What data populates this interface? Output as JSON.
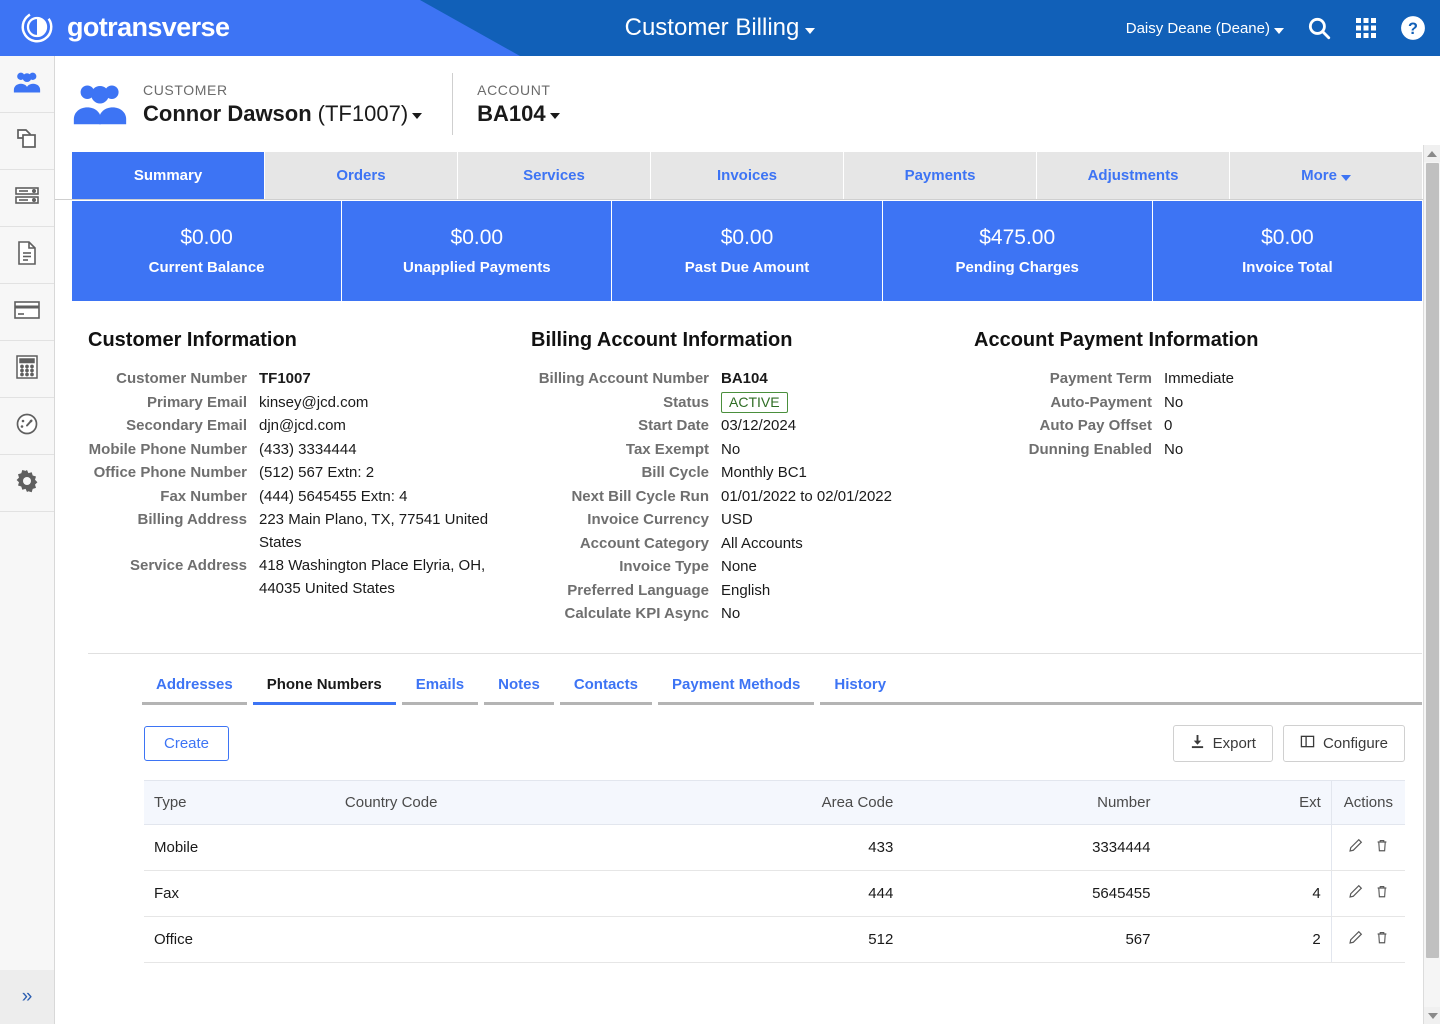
{
  "topbar": {
    "brand": "gotransverse",
    "brand_logo_icon": "gotransverse-circle-logo",
    "app_title": "Customer Billing",
    "user": "Daisy Deane (Deane)",
    "icons": [
      "search-icon",
      "apps-grid-icon",
      "help-circle-icon"
    ],
    "colors": {
      "dark_blue": "#1160b8",
      "light_blue": "#3d74f4"
    }
  },
  "sidebar": {
    "items": [
      {
        "icon": "customers-icon",
        "active": true
      },
      {
        "icon": "products-copy-icon",
        "active": false
      },
      {
        "icon": "servers-stack-icon",
        "active": false
      },
      {
        "icon": "document-icon",
        "active": false
      },
      {
        "icon": "credit-card-icon",
        "active": false
      },
      {
        "icon": "calculator-icon",
        "active": false
      },
      {
        "icon": "dashboard-gauge-icon",
        "active": false
      },
      {
        "icon": "settings-gear-icon",
        "active": false
      }
    ],
    "expand_icon": "double-chevron-right-icon"
  },
  "record_header": {
    "customer_label": "CUSTOMER",
    "customer_name": "Connor Dawson",
    "customer_number_paren": "(TF1007)",
    "account_label": "ACCOUNT",
    "account_value": "BA104",
    "icon": "customers-group-icon"
  },
  "tabs": [
    {
      "label": "Summary",
      "active": true
    },
    {
      "label": "Orders",
      "active": false
    },
    {
      "label": "Services",
      "active": false
    },
    {
      "label": "Invoices",
      "active": false
    },
    {
      "label": "Payments",
      "active": false
    },
    {
      "label": "Adjustments",
      "active": false
    },
    {
      "label": "More",
      "active": false,
      "has_caret": true
    }
  ],
  "kpis": [
    {
      "value": "$0.00",
      "label": "Current Balance"
    },
    {
      "value": "$0.00",
      "label": "Unapplied Payments"
    },
    {
      "value": "$0.00",
      "label": "Past Due Amount"
    },
    {
      "value": "$475.00",
      "label": "Pending Charges"
    },
    {
      "value": "$0.00",
      "label": "Invoice Total"
    }
  ],
  "customer_information": {
    "title": "Customer Information",
    "rows": [
      {
        "key": "Customer Number",
        "value": "TF1007",
        "bold": true
      },
      {
        "key": "Primary Email",
        "value": "kinsey@jcd.com"
      },
      {
        "key": "Secondary Email",
        "value": "djn@jcd.com"
      },
      {
        "key": "Mobile Phone Number",
        "value": "(433) 3334444"
      },
      {
        "key": "Office Phone Number",
        "value": "(512) 567 Extn: 2"
      },
      {
        "key": "Fax Number",
        "value": "(444) 5645455 Extn: 4"
      },
      {
        "key": "Billing Address",
        "value": "223 Main Plano, TX, 77541 United States"
      },
      {
        "key": "Service Address",
        "value": "418 Washington Place Elyria, OH, 44035 United States"
      }
    ]
  },
  "billing_account_information": {
    "title": "Billing Account Information",
    "status_badge": "ACTIVE",
    "rows": [
      {
        "key": "Billing Account Number",
        "value": "BA104",
        "bold": true
      },
      {
        "key": "Status",
        "value": "ACTIVE",
        "badge": true
      },
      {
        "key": "Start Date",
        "value": "03/12/2024"
      },
      {
        "key": "Tax Exempt",
        "value": "No"
      },
      {
        "key": "Bill Cycle",
        "value": "Monthly BC1"
      },
      {
        "key": "Next Bill Cycle Run",
        "value": "01/01/2022 to 02/01/2022"
      },
      {
        "key": "Invoice Currency",
        "value": "USD"
      },
      {
        "key": "Account Category",
        "value": "All Accounts"
      },
      {
        "key": "Invoice Type",
        "value": "None"
      },
      {
        "key": "Preferred Language",
        "value": "English"
      },
      {
        "key": "Calculate KPI Async",
        "value": "No"
      }
    ]
  },
  "account_payment_information": {
    "title": "Account Payment Information",
    "rows": [
      {
        "key": "Payment Term",
        "value": "Immediate"
      },
      {
        "key": "Auto-Payment",
        "value": "No"
      },
      {
        "key": "Auto Pay Offset",
        "value": "0"
      },
      {
        "key": "Dunning Enabled",
        "value": "No"
      }
    ]
  },
  "subtabs": [
    {
      "label": "Addresses",
      "active": false
    },
    {
      "label": "Phone Numbers",
      "active": true
    },
    {
      "label": "Emails",
      "active": false
    },
    {
      "label": "Notes",
      "active": false
    },
    {
      "label": "Contacts",
      "active": false
    },
    {
      "label": "Payment Methods",
      "active": false
    },
    {
      "label": "History",
      "active": false
    }
  ],
  "toolbar": {
    "create_label": "Create",
    "export_label": "Export",
    "export_icon": "download-icon",
    "configure_label": "Configure",
    "configure_icon": "columns-icon"
  },
  "table": {
    "columns": [
      "Type",
      "Country Code",
      "Area Code",
      "Number",
      "Ext",
      "Actions"
    ],
    "rows": [
      {
        "type": "Mobile",
        "country_code": "",
        "area_code": "433",
        "number": "3334444",
        "ext": ""
      },
      {
        "type": "Fax",
        "country_code": "",
        "area_code": "444",
        "number": "5645455",
        "ext": "4"
      },
      {
        "type": "Office",
        "country_code": "",
        "area_code": "512",
        "number": "567",
        "ext": "2"
      }
    ],
    "row_action_icons": [
      "edit-pencil-icon",
      "delete-trash-icon"
    ]
  }
}
